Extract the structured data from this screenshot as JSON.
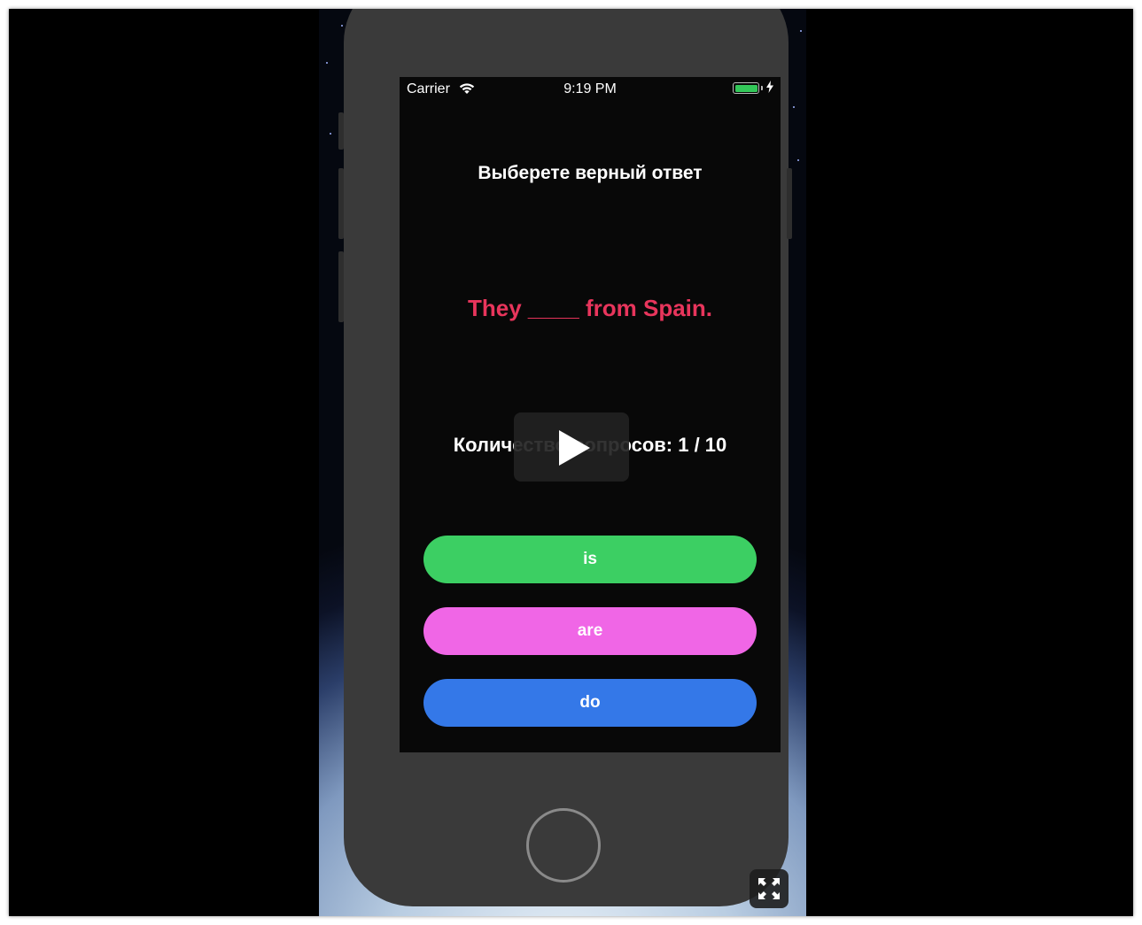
{
  "status_bar": {
    "carrier": "Carrier",
    "time": "9:19 PM",
    "battery_color": "#33c759"
  },
  "quiz": {
    "heading": "Выберете верный ответ",
    "sentence": "They ____ from Spain.",
    "counter": "Количество вопросов: 1 / 10",
    "answers": [
      "is",
      "are",
      "do"
    ],
    "answer_colors": [
      "#3ccf63",
      "#f066e6",
      "#3478e8"
    ],
    "sentence_color": "#e8355c"
  },
  "video_controls": {
    "play_icon": "play-icon",
    "fullscreen_icon": "fullscreen-expand-icon"
  }
}
